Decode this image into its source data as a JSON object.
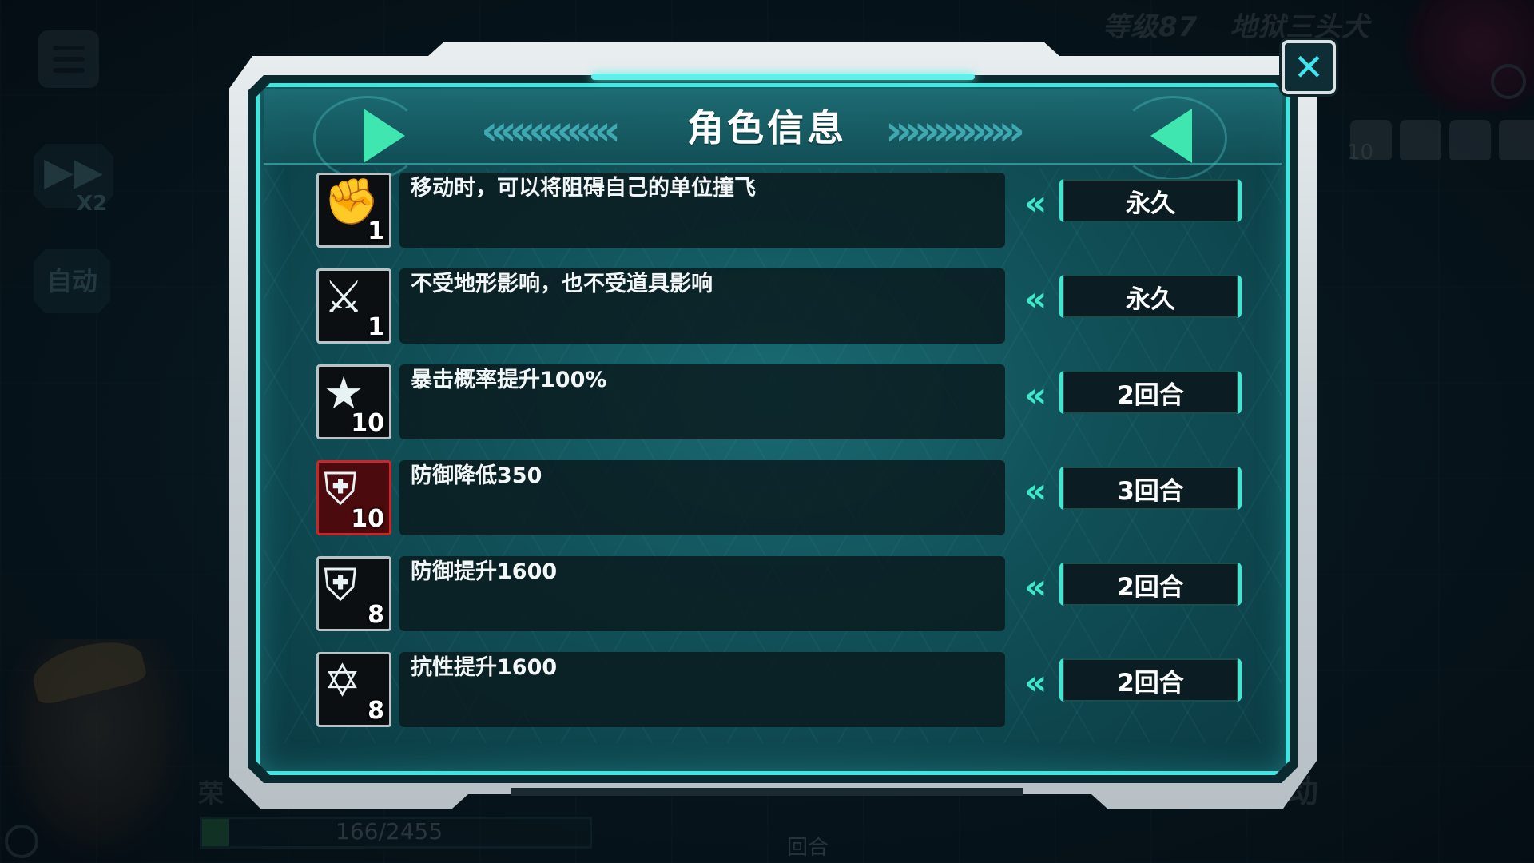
{
  "background": {
    "speed_label": "X2",
    "speed_icon": "▶▶",
    "auto_label": "自动",
    "enemy_level": "等级87",
    "enemy_name": "地狱三头犬",
    "enemy_unit_count": "10",
    "hp_text": "166/2455",
    "hp_fraction": 0.068,
    "round_label": "回合",
    "auto_label_right": "动",
    "rong_label": "荣"
  },
  "dialog": {
    "title": "角色信息",
    "close_glyph": "✕",
    "nav_left_glyph": "«««««««",
    "nav_right_glyph": "»»»»»»»",
    "row_chevron": "«",
    "rows": [
      {
        "icon": "knockback-icon",
        "glyph": "✊",
        "count": "1",
        "text": "移动时，可以将阻碍自己的单位撞飞",
        "duration": "永久",
        "debuff": false
      },
      {
        "icon": "terrain-immune-icon",
        "glyph": "⚔",
        "count": "1",
        "text": "不受地形影响，也不受道具影响",
        "duration": "永久",
        "debuff": false
      },
      {
        "icon": "crit-up-icon",
        "glyph": "★",
        "count": "10",
        "text": "暴击概率提升100%",
        "duration": "2回合",
        "debuff": false
      },
      {
        "icon": "defense-down-icon",
        "glyph": "⛨",
        "count": "10",
        "text": "防御降低350",
        "duration": "3回合",
        "debuff": true
      },
      {
        "icon": "defense-up-icon",
        "glyph": "⛨",
        "count": "8",
        "text": "防御提升1600",
        "duration": "2回合",
        "debuff": false
      },
      {
        "icon": "resistance-up-icon",
        "glyph": "✡",
        "count": "8",
        "text": "抗性提升1600",
        "duration": "2回合",
        "debuff": false
      }
    ]
  },
  "colors": {
    "accent": "#3fe6e0",
    "debuff": "#c8262b",
    "panel": "#0b1d22"
  }
}
